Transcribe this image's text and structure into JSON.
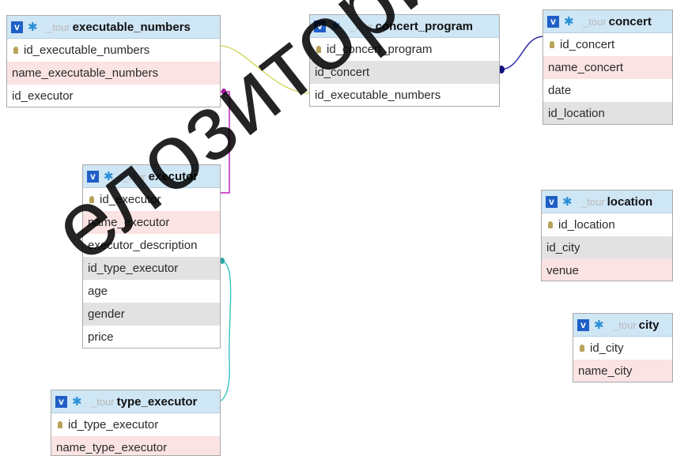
{
  "schema_prefix": "_tour",
  "tables": {
    "executable_numbers": {
      "name": "executable_numbers",
      "columns": [
        "id_executable_numbers",
        "name_executable_numbers",
        "id_executor"
      ]
    },
    "concert_program": {
      "name": "concert_program",
      "columns": [
        "id_concert_program",
        "id_concert",
        "id_executable_numbers"
      ]
    },
    "concert": {
      "name": "concert",
      "columns": [
        "id_concert",
        "name_concert",
        "date",
        "id_location"
      ]
    },
    "executor": {
      "name": "executor",
      "columns": [
        "id_executor",
        "name_executor",
        "executor_description",
        "id_type_executor",
        "age",
        "gender",
        "price"
      ]
    },
    "location": {
      "name": "location",
      "columns": [
        "id_location",
        "id_city",
        "venue"
      ]
    },
    "city": {
      "name": "city",
      "columns": [
        "id_city",
        "name_city"
      ]
    },
    "type_executor": {
      "name": "type_executor",
      "columns": [
        "id_type_executor",
        "name_type_executor"
      ]
    }
  },
  "relation_colors": {
    "executable_numbers_to_concert_program": "#d6d96a",
    "concert_program_to_concert": "#2a2aa8",
    "executable_numbers_to_executor": "#c21fb8",
    "executor_to_type_executor": "#3cc7bf"
  },
  "watermark": "елозитория"
}
